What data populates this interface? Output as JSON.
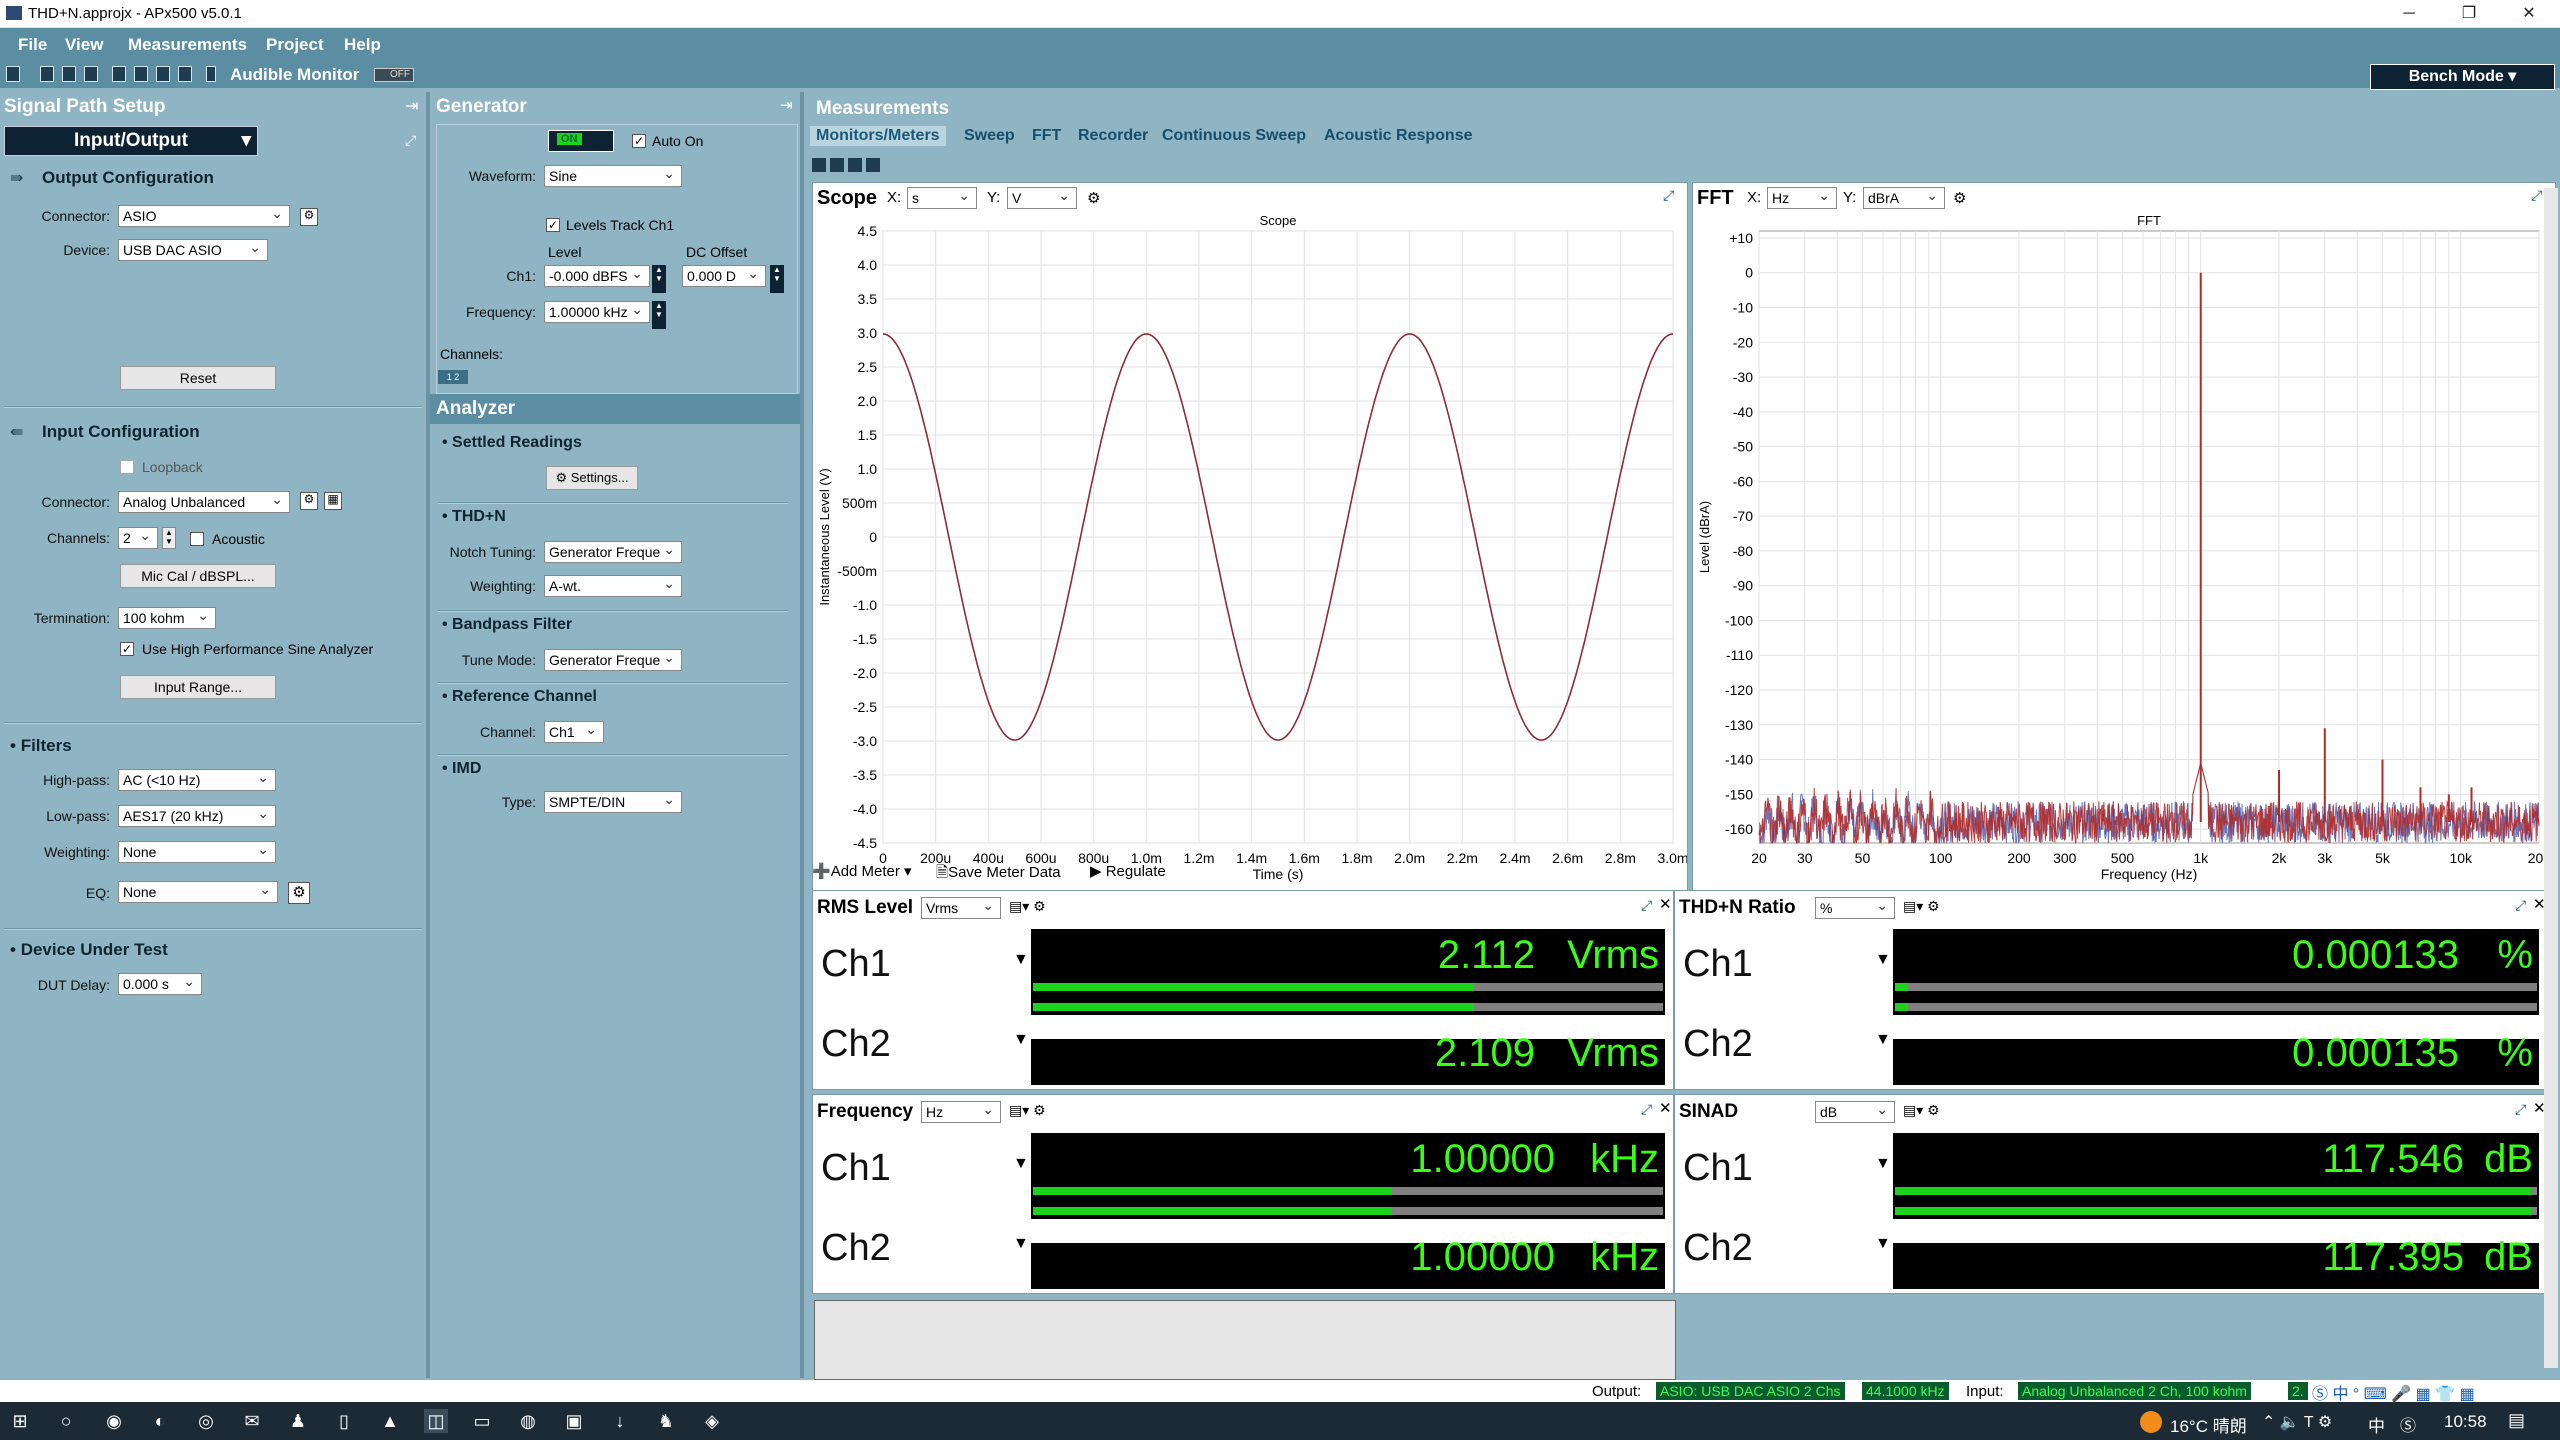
{
  "window": {
    "title": "THD+N.approjx - APx500 v5.0.1"
  },
  "menu": [
    "File",
    "View",
    "Measurements",
    "Project",
    "Help"
  ],
  "toolbar": {
    "audible_monitor": "Audible Monitor",
    "off": "OFF",
    "bench_mode": "Bench Mode"
  },
  "signal_path": {
    "title": "Signal Path Setup",
    "selector": "Input/Output",
    "output_config": "Output Configuration",
    "connector_label": "Connector:",
    "connector_value": "ASIO",
    "device_label": "Device:",
    "device_value": "USB DAC ASIO",
    "reset": "Reset",
    "input_config": "Input Configuration",
    "loopback": "Loopback",
    "in_connector_value": "Analog Unbalanced",
    "channels_label": "Channels:",
    "channels_value": "2",
    "acoustic": "Acoustic",
    "miccal": "Mic Cal / dBSPL...",
    "termination_label": "Termination:",
    "termination_value": "100 kohm",
    "use_hp": "Use High Performance Sine Analyzer",
    "input_range": "Input Range...",
    "filters": "Filters",
    "highpass_label": "High-pass:",
    "highpass_value": "AC (<10 Hz)",
    "lowpass_label": "Low-pass:",
    "lowpass_value": "AES17 (20 kHz)",
    "weighting_label": "Weighting:",
    "weighting_value": "None",
    "eq_label": "EQ:",
    "eq_value": "None",
    "dut": "Device Under Test",
    "dut_delay_label": "DUT Delay:",
    "dut_delay_value": "0.000 s"
  },
  "generator": {
    "title": "Generator",
    "on": "ON",
    "auto_on": "Auto On",
    "waveform_label": "Waveform:",
    "waveform_value": "Sine",
    "levels_track": "Levels Track Ch1",
    "level_hdr": "Level",
    "dc_hdr": "DC Offset",
    "ch1_label": "Ch1:",
    "ch1_level": "-0.000 dBFS",
    "ch1_dc": "0.000 D",
    "freq_label": "Frequency:",
    "freq_value": "1.00000 kHz",
    "channels_label": "Channels:"
  },
  "analyzer": {
    "title": "Analyzer",
    "settled": "Settled Readings",
    "settings": "Settings...",
    "thdn": "THD+N",
    "notch_label": "Notch Tuning:",
    "notch_value": "Generator Freque",
    "weighting_label": "Weighting:",
    "weighting_value": "A-wt.",
    "bandpass": "Bandpass Filter",
    "tune_label": "Tune Mode:",
    "tune_value": "Generator Freque",
    "refch": "Reference Channel",
    "channel_label": "Channel:",
    "channel_value": "Ch1",
    "imd": "IMD",
    "type_label": "Type:",
    "type_value": "SMPTE/DIN"
  },
  "measurements": {
    "title": "Measurements",
    "tabs": [
      "Monitors/Meters",
      "Sweep",
      "FFT",
      "Recorder",
      "Continuous Sweep",
      "Acoustic Response"
    ],
    "add_meter": "Add Meter",
    "save_meter": "Save Meter Data",
    "regulate": "Regulate"
  },
  "scope": {
    "name": "Scope",
    "x_label": "X:",
    "x_unit": "s",
    "y_label": "Y:",
    "y_unit": "V",
    "plot_title": "Scope",
    "xlabel": "Time (s)",
    "ylabel": "Instantaneous Level (V)",
    "yticks": [
      "4.5",
      "4.0",
      "3.5",
      "3.0",
      "2.5",
      "2.0",
      "1.5",
      "1.0",
      "500m",
      "0",
      "-500m",
      "-1.0",
      "-1.5",
      "-2.0",
      "-2.5",
      "-3.0",
      "-3.5",
      "-4.0",
      "-4.5"
    ],
    "xticks": [
      "0",
      "200u",
      "400u",
      "600u",
      "800u",
      "1.0m",
      "1.2m",
      "1.4m",
      "1.6m",
      "1.8m",
      "2.0m",
      "2.2m",
      "2.4m",
      "2.6m",
      "2.8m",
      "3.0m"
    ]
  },
  "fft": {
    "name": "FFT",
    "x_label": "X:",
    "x_unit": "Hz",
    "y_label": "Y:",
    "y_unit": "dBrA",
    "plot_title": "FFT",
    "xlabel": "Frequency (Hz)",
    "ylabel": "Level (dBrA)",
    "yticks": [
      "+10",
      "0",
      "-10",
      "-20",
      "-30",
      "-40",
      "-50",
      "-60",
      "-70",
      "-80",
      "-90",
      "-100",
      "-110",
      "-120",
      "-130",
      "-140",
      "-150",
      "-160"
    ],
    "xticks": [
      "20",
      "30",
      "50",
      "100",
      "200",
      "300",
      "500",
      "1k",
      "2k",
      "3k",
      "5k",
      "10k",
      "20k"
    ]
  },
  "chart_data": [
    {
      "type": "line",
      "title": "Scope",
      "xlabel": "Time (s)",
      "ylabel": "Instantaneous Level (V)",
      "xlim": [
        0,
        0.003
      ],
      "ylim": [
        -4.5,
        4.5
      ],
      "grid": true,
      "series": [
        {
          "frequency_hz": 1000,
          "amplitude_v": 2.986,
          "start_time_s": -0.00025,
          "values_desc": "sine"
        }
      ]
    },
    {
      "type": "line",
      "title": "FFT",
      "xlabel": "Frequency (Hz)",
      "ylabel": "Level (dBrA)",
      "xlim": [
        20,
        20000
      ],
      "ylim": [
        -165,
        10
      ],
      "x_scale": "log",
      "grid": true,
      "series": [
        {
          "peaks": [
            {
              "x": 1000,
              "y": 0
            },
            {
              "x": 2000,
              "y": -143
            },
            {
              "x": 3000,
              "y": -131
            },
            {
              "x": 5000,
              "y": -140
            },
            {
              "x": 7000,
              "y": -148
            },
            {
              "x": 9000,
              "y": -150
            },
            {
              "x": 11000,
              "y": -148
            }
          ],
          "noise_floor_db": -158
        }
      ]
    }
  ],
  "meters": [
    {
      "title": "RMS Level",
      "unit_sel": "Vrms",
      "ch1": "2.112",
      "ch2": "2.109",
      "unit": "Vrms",
      "fill1": 0.7,
      "fill2": 0.7
    },
    {
      "title": "THD+N Ratio",
      "unit_sel": "%",
      "ch1": "0.000133",
      "ch2": "0.000135",
      "unit": "%",
      "fill1": 0.02,
      "fill2": 0.02
    },
    {
      "title": "Frequency",
      "unit_sel": "Hz",
      "ch1": "1.00000",
      "ch2": "1.00000",
      "unit": "kHz",
      "fill1": 0.57,
      "fill2": 0.57
    },
    {
      "title": "SINAD",
      "unit_sel": "dB",
      "ch1": "117.546",
      "ch2": "117.395",
      "unit": "dB",
      "fill1": 0.99,
      "fill2": 0.99
    }
  ],
  "ch_labels": [
    "Ch1",
    "Ch2"
  ],
  "status": {
    "output_label": "Output:",
    "output_value": "ASIO: USB DAC ASIO 2 Chs",
    "rate": "44.1000 kHz",
    "input_label": "Input:",
    "input_value": "Analog Unbalanced 2 Ch, 100 kohm",
    "more": "2."
  },
  "taskbar": {
    "temp": "16°C 晴朗",
    "ime": "中",
    "time": "10:58"
  }
}
